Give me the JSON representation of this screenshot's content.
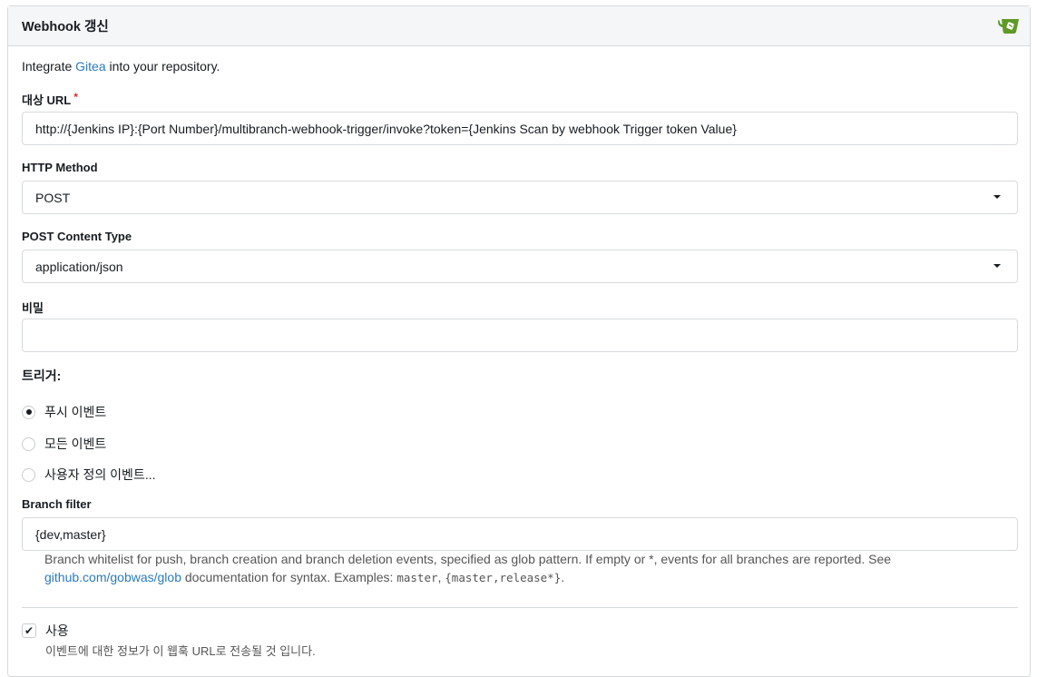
{
  "header": {
    "title": "Webhook 갱신",
    "logo_icon": "gitea-icon",
    "brand_color": "#609926"
  },
  "intro": {
    "prefix": "Integrate ",
    "link": "Gitea",
    "suffix": " into your repository."
  },
  "target_url": {
    "label": "대상 URL",
    "required_mark": "*",
    "value": "http://{Jenkins IP}:{Port Number}/multibranch-webhook-trigger/invoke?token={Jenkins Scan by webhook Trigger token Value}"
  },
  "http_method": {
    "label": "HTTP Method",
    "value": "POST"
  },
  "content_type": {
    "label": "POST Content Type",
    "value": "application/json"
  },
  "secret": {
    "label": "비밀",
    "value": ""
  },
  "trigger": {
    "title": "트리거:",
    "options": [
      {
        "label": "푸시 이벤트",
        "checked": true
      },
      {
        "label": "모든 이벤트",
        "checked": false
      },
      {
        "label": "사용자 정의 이벤트...",
        "checked": false
      }
    ]
  },
  "branch_filter": {
    "label": "Branch filter",
    "value": "{dev,master}",
    "help_part1": "Branch whitelist for push, branch creation and branch deletion events, specified as glob pattern. If empty or ",
    "help_star": "*",
    "help_part2": ", events for all branches are reported. See",
    "help_link": "github.com/gobwas/glob",
    "help_part3": " documentation for syntax. Examples: ",
    "example1": "master",
    "example_sep": ", ",
    "example2": "{master,release*}",
    "help_end": "."
  },
  "active": {
    "label": "사용",
    "checked": true,
    "description": "이벤트에 대한 정보가 이 웹훅 URL로 전송될 것 입니다."
  }
}
